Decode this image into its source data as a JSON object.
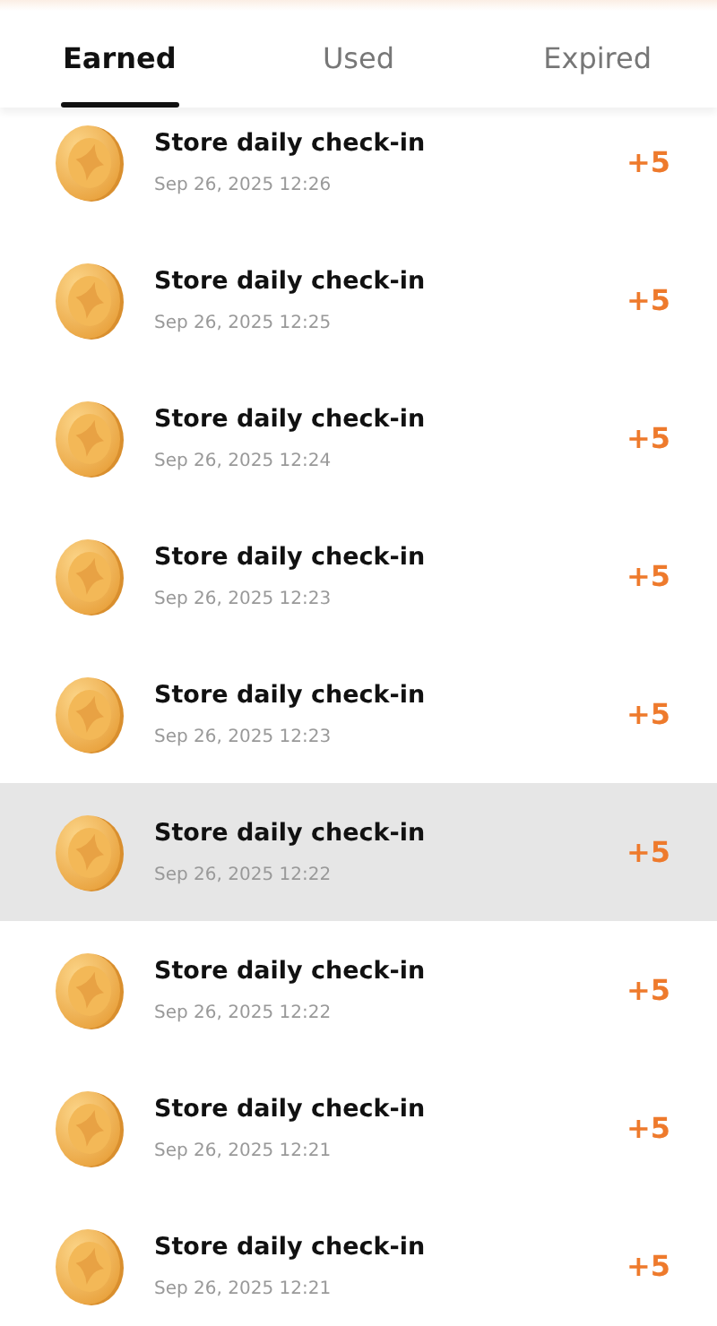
{
  "tabs": [
    {
      "label": "Earned",
      "selected": true
    },
    {
      "label": "Used",
      "selected": false
    },
    {
      "label": "Expired",
      "selected": false
    }
  ],
  "records": [
    {
      "title": "Store daily check-in",
      "time": "Sep 26, 2025 12:26",
      "points": "+5",
      "highlighted": false
    },
    {
      "title": "Store daily check-in",
      "time": "Sep 26, 2025 12:25",
      "points": "+5",
      "highlighted": false
    },
    {
      "title": "Store daily check-in",
      "time": "Sep 26, 2025 12:24",
      "points": "+5",
      "highlighted": false
    },
    {
      "title": "Store daily check-in",
      "time": "Sep 26, 2025 12:23",
      "points": "+5",
      "highlighted": false
    },
    {
      "title": "Store daily check-in",
      "time": "Sep 26, 2025 12:23",
      "points": "+5",
      "highlighted": false
    },
    {
      "title": "Store daily check-in",
      "time": "Sep 26, 2025 12:22",
      "points": "+5",
      "highlighted": true
    },
    {
      "title": "Store daily check-in",
      "time": "Sep 26, 2025 12:22",
      "points": "+5",
      "highlighted": false
    },
    {
      "title": "Store daily check-in",
      "time": "Sep 26, 2025 12:21",
      "points": "+5",
      "highlighted": false
    },
    {
      "title": "Store daily check-in",
      "time": "Sep 26, 2025 12:21",
      "points": "+5",
      "highlighted": false
    }
  ]
}
